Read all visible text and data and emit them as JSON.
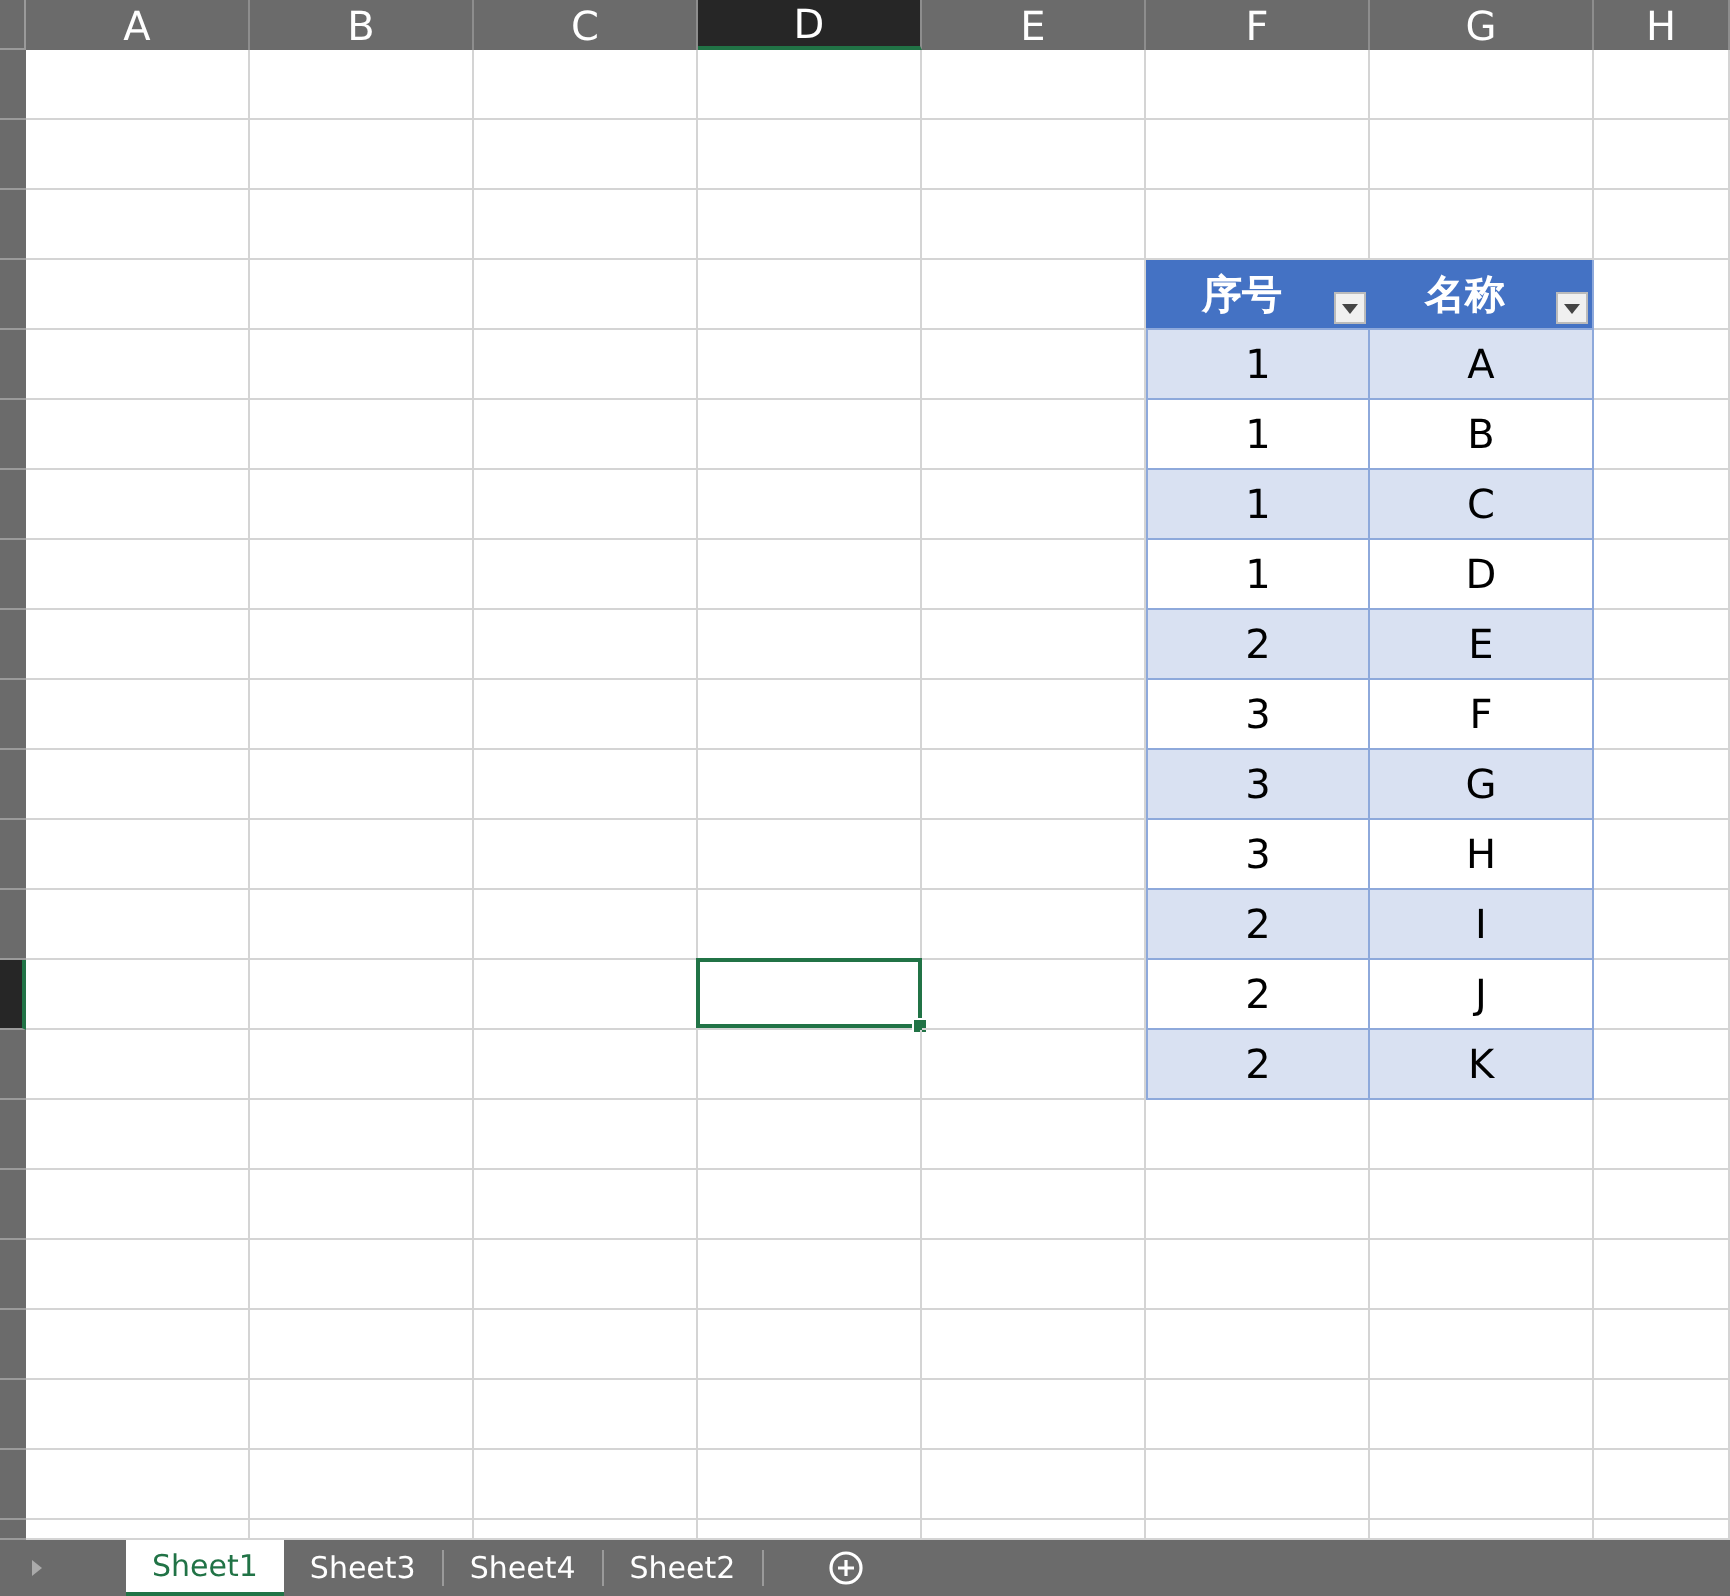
{
  "columns": [
    {
      "label": "A",
      "selected": false
    },
    {
      "label": "B",
      "selected": false
    },
    {
      "label": "C",
      "selected": false
    },
    {
      "label": "D",
      "selected": true
    },
    {
      "label": "E",
      "selected": false
    },
    {
      "label": "F",
      "selected": false
    },
    {
      "label": "G",
      "selected": false
    },
    {
      "label": "H",
      "selected": false
    }
  ],
  "rows": [
    {
      "selected": false
    },
    {
      "selected": false
    },
    {
      "selected": false
    },
    {
      "selected": false
    },
    {
      "selected": false
    },
    {
      "selected": false
    },
    {
      "selected": false
    },
    {
      "selected": false
    },
    {
      "selected": false
    },
    {
      "selected": false
    },
    {
      "selected": false
    },
    {
      "selected": false
    },
    {
      "selected": false
    },
    {
      "selected": true
    },
    {
      "selected": false
    },
    {
      "selected": false
    },
    {
      "selected": false
    },
    {
      "selected": false
    },
    {
      "selected": false
    },
    {
      "selected": false
    },
    {
      "selected": false
    },
    {
      "selected": false
    }
  ],
  "table": {
    "columns": [
      "序号",
      "名称"
    ],
    "rows": [
      [
        "1",
        "A"
      ],
      [
        "1",
        "B"
      ],
      [
        "1",
        "C"
      ],
      [
        "1",
        "D"
      ],
      [
        "2",
        "E"
      ],
      [
        "3",
        "F"
      ],
      [
        "3",
        "G"
      ],
      [
        "3",
        "H"
      ],
      [
        "2",
        "I"
      ],
      [
        "2",
        "J"
      ],
      [
        "2",
        "K"
      ]
    ]
  },
  "sheet_tabs": [
    {
      "label": "Sheet1",
      "selected": true
    },
    {
      "label": "Sheet3",
      "selected": false
    },
    {
      "label": "Sheet4",
      "selected": false
    },
    {
      "label": "Sheet2",
      "selected": false
    }
  ]
}
